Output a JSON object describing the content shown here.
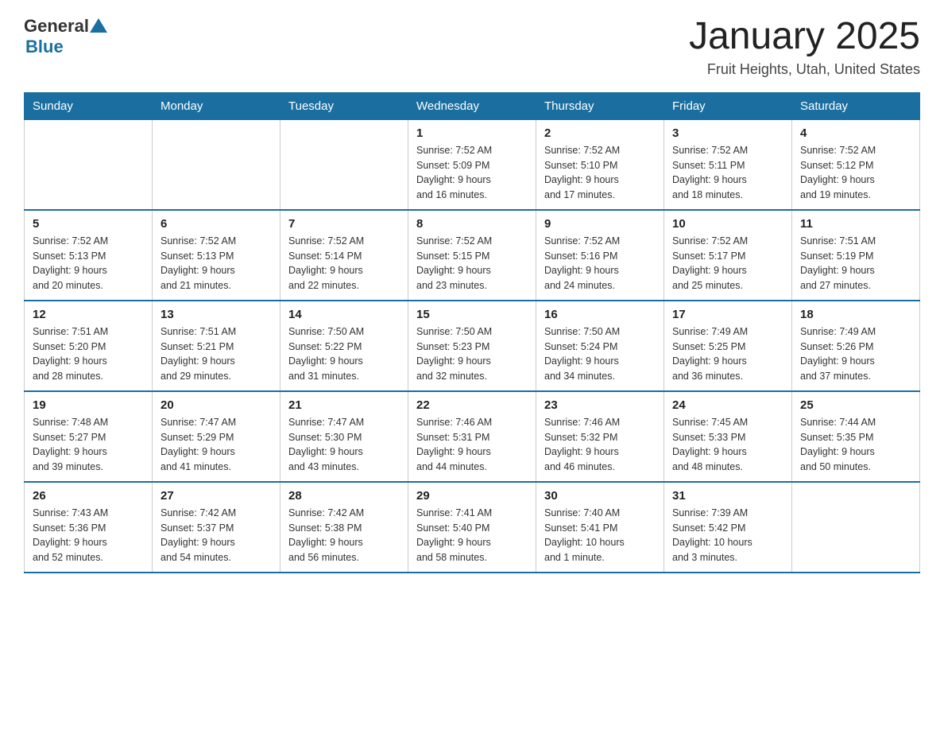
{
  "header": {
    "logo_general": "General",
    "logo_blue": "Blue",
    "title": "January 2025",
    "subtitle": "Fruit Heights, Utah, United States"
  },
  "days_of_week": [
    "Sunday",
    "Monday",
    "Tuesday",
    "Wednesday",
    "Thursday",
    "Friday",
    "Saturday"
  ],
  "weeks": [
    [
      {
        "day": "",
        "info": ""
      },
      {
        "day": "",
        "info": ""
      },
      {
        "day": "",
        "info": ""
      },
      {
        "day": "1",
        "info": "Sunrise: 7:52 AM\nSunset: 5:09 PM\nDaylight: 9 hours\nand 16 minutes."
      },
      {
        "day": "2",
        "info": "Sunrise: 7:52 AM\nSunset: 5:10 PM\nDaylight: 9 hours\nand 17 minutes."
      },
      {
        "day": "3",
        "info": "Sunrise: 7:52 AM\nSunset: 5:11 PM\nDaylight: 9 hours\nand 18 minutes."
      },
      {
        "day": "4",
        "info": "Sunrise: 7:52 AM\nSunset: 5:12 PM\nDaylight: 9 hours\nand 19 minutes."
      }
    ],
    [
      {
        "day": "5",
        "info": "Sunrise: 7:52 AM\nSunset: 5:13 PM\nDaylight: 9 hours\nand 20 minutes."
      },
      {
        "day": "6",
        "info": "Sunrise: 7:52 AM\nSunset: 5:13 PM\nDaylight: 9 hours\nand 21 minutes."
      },
      {
        "day": "7",
        "info": "Sunrise: 7:52 AM\nSunset: 5:14 PM\nDaylight: 9 hours\nand 22 minutes."
      },
      {
        "day": "8",
        "info": "Sunrise: 7:52 AM\nSunset: 5:15 PM\nDaylight: 9 hours\nand 23 minutes."
      },
      {
        "day": "9",
        "info": "Sunrise: 7:52 AM\nSunset: 5:16 PM\nDaylight: 9 hours\nand 24 minutes."
      },
      {
        "day": "10",
        "info": "Sunrise: 7:52 AM\nSunset: 5:17 PM\nDaylight: 9 hours\nand 25 minutes."
      },
      {
        "day": "11",
        "info": "Sunrise: 7:51 AM\nSunset: 5:19 PM\nDaylight: 9 hours\nand 27 minutes."
      }
    ],
    [
      {
        "day": "12",
        "info": "Sunrise: 7:51 AM\nSunset: 5:20 PM\nDaylight: 9 hours\nand 28 minutes."
      },
      {
        "day": "13",
        "info": "Sunrise: 7:51 AM\nSunset: 5:21 PM\nDaylight: 9 hours\nand 29 minutes."
      },
      {
        "day": "14",
        "info": "Sunrise: 7:50 AM\nSunset: 5:22 PM\nDaylight: 9 hours\nand 31 minutes."
      },
      {
        "day": "15",
        "info": "Sunrise: 7:50 AM\nSunset: 5:23 PM\nDaylight: 9 hours\nand 32 minutes."
      },
      {
        "day": "16",
        "info": "Sunrise: 7:50 AM\nSunset: 5:24 PM\nDaylight: 9 hours\nand 34 minutes."
      },
      {
        "day": "17",
        "info": "Sunrise: 7:49 AM\nSunset: 5:25 PM\nDaylight: 9 hours\nand 36 minutes."
      },
      {
        "day": "18",
        "info": "Sunrise: 7:49 AM\nSunset: 5:26 PM\nDaylight: 9 hours\nand 37 minutes."
      }
    ],
    [
      {
        "day": "19",
        "info": "Sunrise: 7:48 AM\nSunset: 5:27 PM\nDaylight: 9 hours\nand 39 minutes."
      },
      {
        "day": "20",
        "info": "Sunrise: 7:47 AM\nSunset: 5:29 PM\nDaylight: 9 hours\nand 41 minutes."
      },
      {
        "day": "21",
        "info": "Sunrise: 7:47 AM\nSunset: 5:30 PM\nDaylight: 9 hours\nand 43 minutes."
      },
      {
        "day": "22",
        "info": "Sunrise: 7:46 AM\nSunset: 5:31 PM\nDaylight: 9 hours\nand 44 minutes."
      },
      {
        "day": "23",
        "info": "Sunrise: 7:46 AM\nSunset: 5:32 PM\nDaylight: 9 hours\nand 46 minutes."
      },
      {
        "day": "24",
        "info": "Sunrise: 7:45 AM\nSunset: 5:33 PM\nDaylight: 9 hours\nand 48 minutes."
      },
      {
        "day": "25",
        "info": "Sunrise: 7:44 AM\nSunset: 5:35 PM\nDaylight: 9 hours\nand 50 minutes."
      }
    ],
    [
      {
        "day": "26",
        "info": "Sunrise: 7:43 AM\nSunset: 5:36 PM\nDaylight: 9 hours\nand 52 minutes."
      },
      {
        "day": "27",
        "info": "Sunrise: 7:42 AM\nSunset: 5:37 PM\nDaylight: 9 hours\nand 54 minutes."
      },
      {
        "day": "28",
        "info": "Sunrise: 7:42 AM\nSunset: 5:38 PM\nDaylight: 9 hours\nand 56 minutes."
      },
      {
        "day": "29",
        "info": "Sunrise: 7:41 AM\nSunset: 5:40 PM\nDaylight: 9 hours\nand 58 minutes."
      },
      {
        "day": "30",
        "info": "Sunrise: 7:40 AM\nSunset: 5:41 PM\nDaylight: 10 hours\nand 1 minute."
      },
      {
        "day": "31",
        "info": "Sunrise: 7:39 AM\nSunset: 5:42 PM\nDaylight: 10 hours\nand 3 minutes."
      },
      {
        "day": "",
        "info": ""
      }
    ]
  ],
  "colors": {
    "header_bg": "#1a6fa0",
    "header_text": "#ffffff",
    "border": "#cccccc",
    "day_number": "#222222",
    "info_text": "#333333"
  }
}
